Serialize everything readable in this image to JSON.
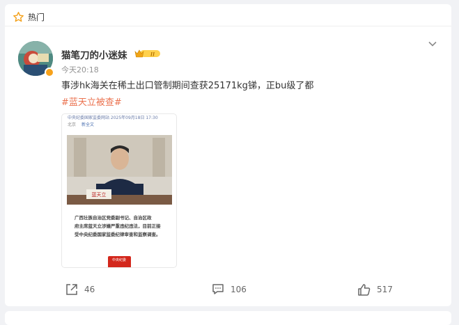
{
  "section": {
    "label": "热门"
  },
  "post": {
    "username": "猫笔刀的小迷妹",
    "level_badge": "II",
    "time": "今天20:18",
    "text": "事涉hk海关在稀土出口管制期间查获25171kg锑，正bu级了都",
    "topic": "#蓝天立被查#",
    "image": {
      "header": "中央纪委国家监委网站  2025年09月18日 17:30",
      "place": "北京",
      "read_full": "新全文",
      "nameplate": "蓝天立",
      "caption": [
        "广西壮族自治区党委副书记、自治区政",
        "府主席蓝天立涉嫌严重违纪违法，目前正接",
        "受中央纪委国家监委纪律审查和监察调查。"
      ],
      "stamp": "中央纪委"
    },
    "actions": {
      "reposts": "46",
      "comments": "106",
      "likes": "517"
    }
  },
  "colors": {
    "topic": "#eb7350",
    "background": "#f1f2f5",
    "verified_badge": "#f7a21b"
  }
}
